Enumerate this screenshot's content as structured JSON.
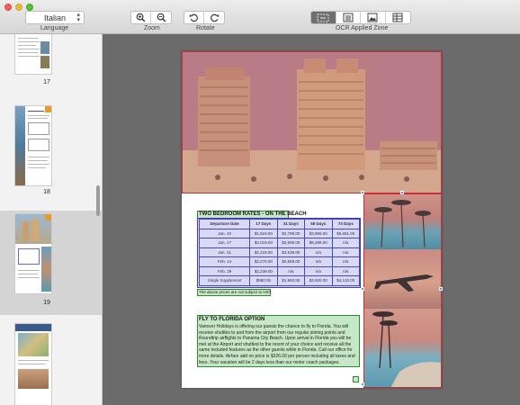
{
  "toolbar": {
    "language_value": "Italian",
    "language_label": "Language",
    "zoom_label": "Zoom",
    "rotate_label": "Rotate",
    "ocr_zone_label": "OCR Applied Zone"
  },
  "sidebar": {
    "pages": [
      {
        "number": "17"
      },
      {
        "number": "18"
      },
      {
        "number": "19",
        "selected": true
      },
      {
        "number": ""
      }
    ]
  },
  "document": {
    "table_title": "TWO BEDROOM RATES - ON THE BEACH",
    "table_headers": [
      "Departure Date",
      "17 Days",
      "31 Days",
      "59 Days",
      "73 Days"
    ],
    "table_rows": [
      [
        "Jan. 10",
        "$1,919.00",
        "$2,799.00",
        "$3,969.00",
        "$5,691.00"
      ],
      [
        "Jan. 17",
        "$2,019.00",
        "$2,999.00",
        "$5,285.00",
        "n/a"
      ],
      [
        "Jan. 31",
        "$2,219.00",
        "$3,639.00",
        "n/a",
        "n/a"
      ],
      [
        "Feb. 14",
        "$2,279.00",
        "$2,669.00",
        "n/a",
        "n/a"
      ],
      [
        "Feb. 28",
        "$2,239.00",
        "n/a",
        "n/a",
        "n/a"
      ],
      [
        "Single Supplement",
        "$980.00",
        "$1,960.00",
        "$3,920.00",
        "$4,120.00"
      ]
    ],
    "table_note": "The above prices are not subject to HST",
    "fly_title": "FLY TO FLORIDA OPTION",
    "fly_text": "Vanover Holidays is offering our guests the chance to fly to Florida. You will receive shuttles to and from the airport from our regular joining points and Roundtrip airflights to Panama City Beach. Upon arrival in Florida you will be met at the Airport and shuttled to the resort of your choice and receive all the same included features as the other guests while in Florida. Call our office for more details. Airfare add on price is $326.00 per person including all taxes and fees. Your vacation will be 2 days less than our motor coach packages."
  },
  "colors": {
    "zone_image": "#c8303a",
    "zone_text": "#2d8a2d",
    "zone_table": "#3c3cc0"
  }
}
